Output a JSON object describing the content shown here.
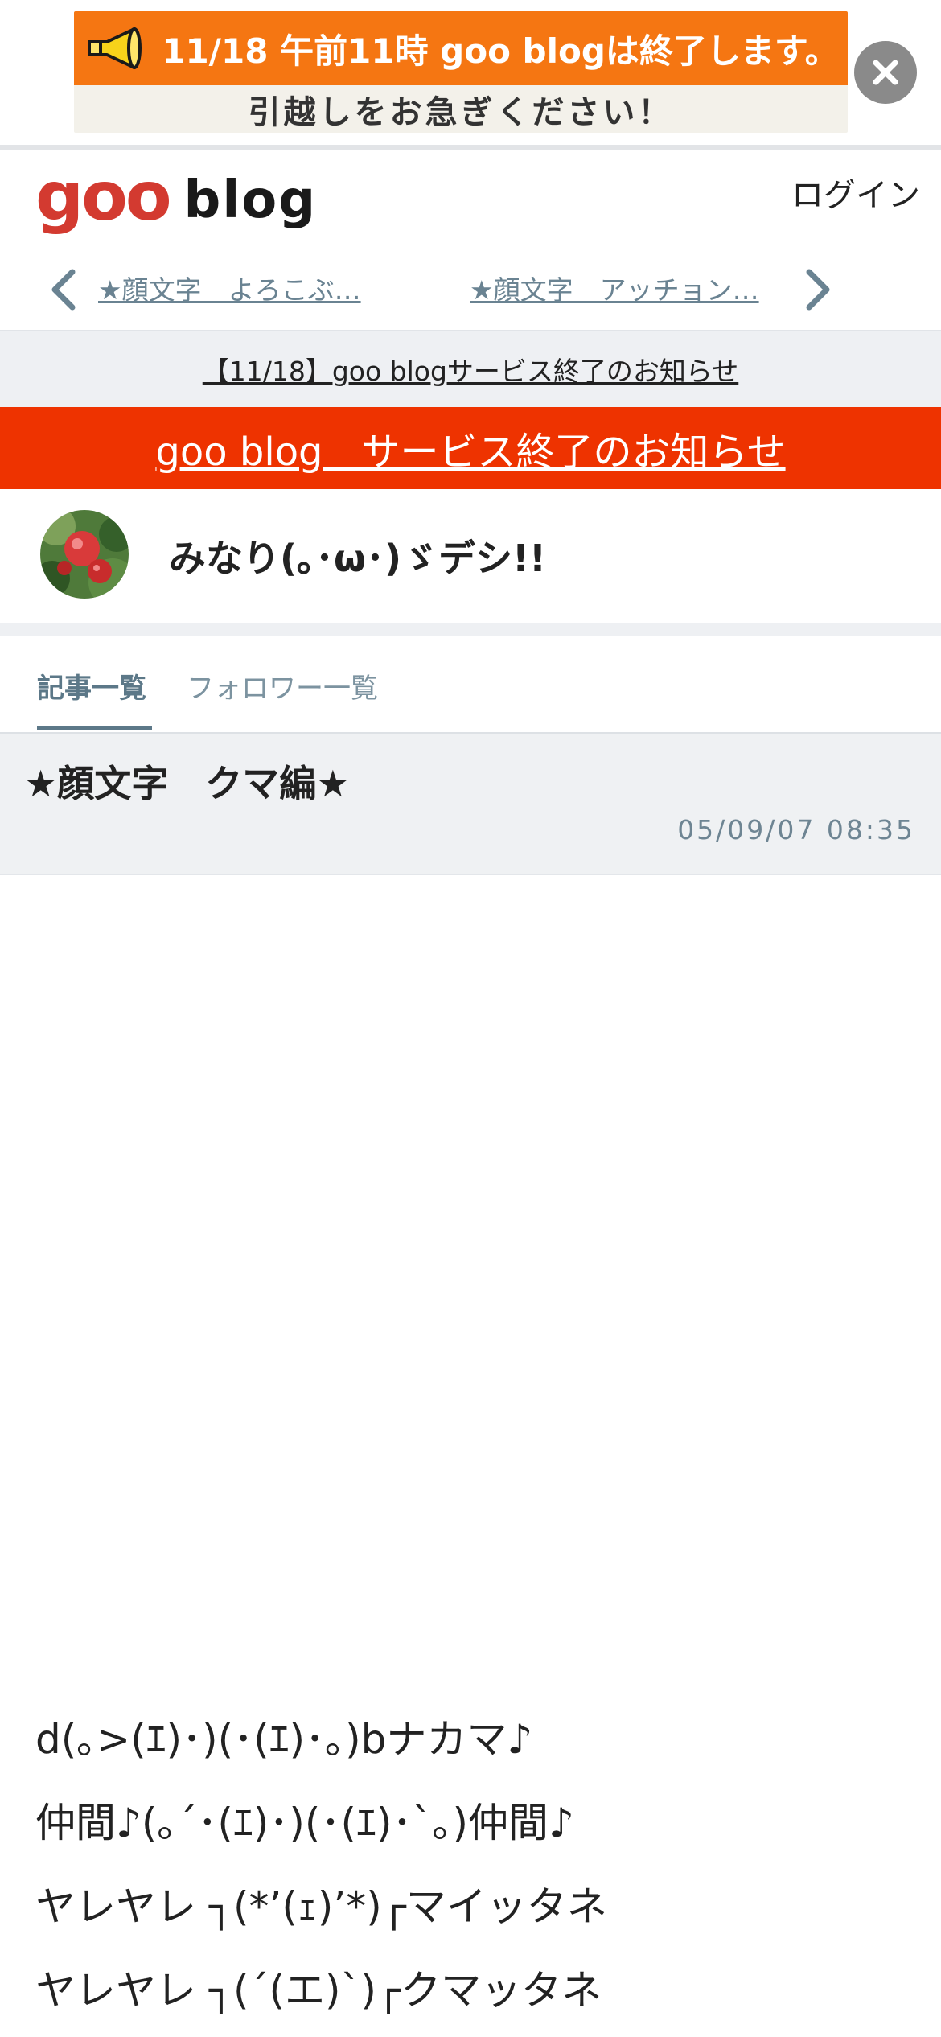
{
  "ad": {
    "line1": "11/18 午前11時 goo blogは終了します。",
    "line2": "引越しをお急ぎください！",
    "close_icon": "close-icon",
    "colors": {
      "top": "#f57612",
      "bottom": "#f3f1ea"
    }
  },
  "header": {
    "logo_goo": "goo",
    "logo_blog": "blog",
    "login": "ログイン"
  },
  "pager": {
    "prev_label": "★顔文字　よろこぶ…",
    "next_label": "★顔文字　アッチョン…",
    "prev_icon": "chevron-left-icon",
    "next_icon": "chevron-right-icon"
  },
  "notice": {
    "text": "【11/18】goo blogサービス終了のお知らせ"
  },
  "announcement": {
    "text": "goo blog　サービス終了のお知らせ",
    "color": "#ee3300"
  },
  "profile": {
    "blog_name": "みなり(｡･ω･)ゞデシ!!"
  },
  "tabs": [
    {
      "label": "記事一覧",
      "active": true
    },
    {
      "label": "フォロワー一覧",
      "active": false
    }
  ],
  "article": {
    "title": "★顔文字　クマ編★",
    "date": "05/09/07 08:35",
    "lines": [
      "d(｡>(ｴ)･)(･(ｴ)･｡)bナカマ♪",
      "仲間♪(｡´･(ｴ)･)(･(ｴ)･`｡)仲間♪",
      "ヤレヤレ ┐(*’(ｪ)’*)┌マイッタネ",
      "ヤレヤレ ┐(´(エ)`)┌クマッタネ"
    ]
  }
}
